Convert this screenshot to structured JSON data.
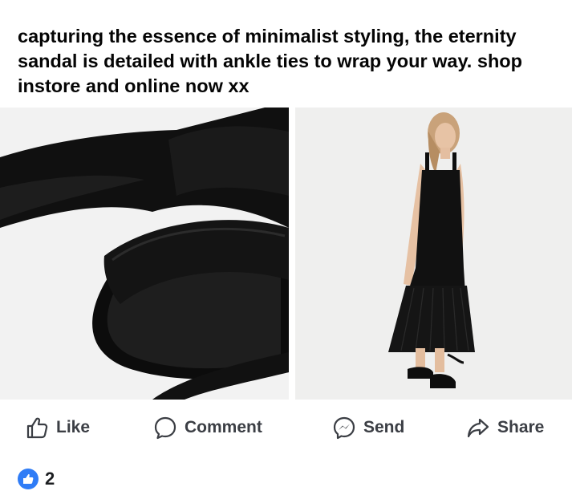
{
  "post": {
    "text": "capturing the essence of minimalist styling, the eternity sandal is detailed with ankle ties to wrap your way. shop instore and online now xx"
  },
  "photos": [
    {
      "name": "sandal-closeup-photo",
      "subject": "black strappy sandal with ankle ties"
    },
    {
      "name": "model-dress-photo",
      "subject": "model in black sleeveless maxi dress and sandals"
    }
  ],
  "actions": {
    "like": {
      "label": "Like",
      "icon": "thumbs-up-icon"
    },
    "comment": {
      "label": "Comment",
      "icon": "comment-bubble-icon"
    },
    "send": {
      "label": "Send",
      "icon": "messenger-icon"
    },
    "share": {
      "label": "Share",
      "icon": "share-arrow-icon"
    }
  },
  "reactions": {
    "count": "2",
    "icon": "like-reaction-icon"
  },
  "colors": {
    "action_text": "#3b3e44",
    "reaction_blue": "#2f7cf6"
  }
}
